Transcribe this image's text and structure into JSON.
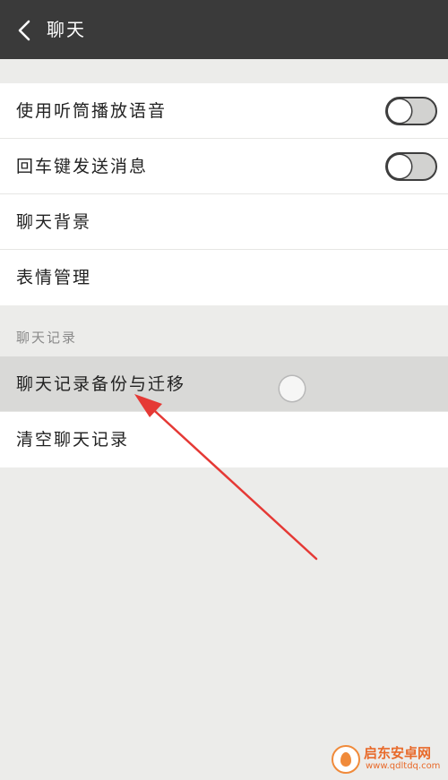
{
  "header": {
    "title": "聊天",
    "back_icon": "chevron-left-icon"
  },
  "settings": {
    "items": [
      {
        "label": "使用听筒播放语音",
        "toggle": false
      },
      {
        "label": "回车键发送消息",
        "toggle": false
      },
      {
        "label": "聊天背景"
      },
      {
        "label": "表情管理"
      }
    ]
  },
  "chat_history": {
    "section_title": "聊天记录",
    "items": [
      {
        "label": "聊天记录备份与迁移",
        "highlighted": true
      },
      {
        "label": "清空聊天记录"
      }
    ]
  },
  "annotation": {
    "arrow_color": "#e53935"
  },
  "watermark": {
    "title": "启东安卓网",
    "url": "www.qdltdq.com"
  },
  "colors": {
    "header_bg": "#3a3a3a",
    "page_bg": "#ececea",
    "highlight_row": "#d9d9d7"
  }
}
